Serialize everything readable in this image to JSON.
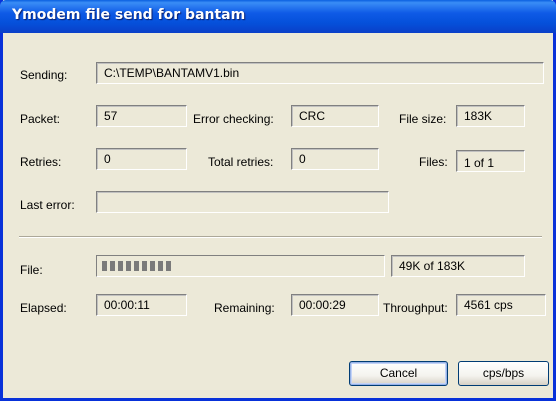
{
  "window": {
    "title": "Ymodem file send for bantam"
  },
  "sending": {
    "label": "Sending:",
    "value": "C:\\TEMP\\BANTAMV1.bin"
  },
  "packet": {
    "label": "Packet:",
    "value": "57"
  },
  "error_checking": {
    "label": "Error checking:",
    "value": "CRC"
  },
  "file_size": {
    "label": "File size:",
    "value": "183K"
  },
  "retries": {
    "label": "Retries:",
    "value": "0"
  },
  "total_retries": {
    "label": "Total retries:",
    "value": "0"
  },
  "files": {
    "label": "Files:",
    "value": "1 of 1"
  },
  "last_error": {
    "label": "Last error:",
    "value": ""
  },
  "file_progress": {
    "label": "File:",
    "fraction": 0.27,
    "text": "49K of 183K"
  },
  "elapsed": {
    "label": "Elapsed:",
    "value": "00:00:11"
  },
  "remaining": {
    "label": "Remaining:",
    "value": "00:00:29"
  },
  "throughput": {
    "label": "Throughput:",
    "value": "4561 cps"
  },
  "buttons": {
    "cancel": "Cancel",
    "units": "cps/bps"
  },
  "colors": {
    "titlebar": "#0550da",
    "dialog_background": "#ece9d8",
    "button_border": "#003c74"
  }
}
